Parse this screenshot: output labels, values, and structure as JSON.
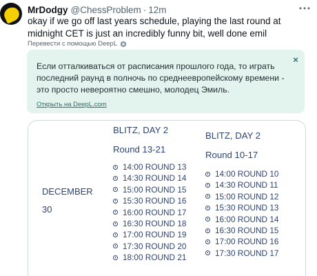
{
  "tweet": {
    "display_name": "MrDodgy",
    "handle": "@ChessProblem",
    "separator": "·",
    "time": "12m",
    "more_icon": "more-horizontal-icon",
    "text": "okay if we go off last years schedule, playing the last round at midnight CET is just an incredibly funny bit, well done emil",
    "translate_label": "Перевести с помощью DeepL"
  },
  "translation": {
    "text": "Если отталкиваться от расписания прошлого года, то играть последний раунд в полночь по среднеевропейскому времени - это просто невероятно смешно, молодец Эмиль.",
    "link": "Открыть на DeepL.com",
    "close_icon": "×"
  },
  "schedule": {
    "date_month": "DECEMBER",
    "date_day": "30",
    "left": {
      "title": "BLITZ, DAY 2",
      "subtitle": "Round 13-21",
      "rounds": [
        "14:00 ROUND 13",
        "14:30 ROUND 14",
        "15:00 ROUND 15",
        "15:30 ROUND 16",
        "16:00 ROUND 17",
        "16:30 ROUND 18",
        "17:00 ROUND 19",
        "17:30 ROUND 20",
        "18:00 ROUND 21"
      ]
    },
    "right": {
      "title": "BLITZ, DAY 2",
      "subtitle": "Round 10-17",
      "rounds": [
        "14:00 ROUND 10",
        "14:30 ROUND 11",
        "15:00 ROUND 12",
        "15:30 ROUND 13",
        "16:00 ROUND 14",
        "16:30 ROUND 15",
        "17:00 ROUND 16",
        "17:30 ROUND 17"
      ]
    }
  },
  "colors": {
    "translation_bg": "#e3f4ee",
    "schedule_text": "#2f4470",
    "muted_text": "#536471"
  }
}
